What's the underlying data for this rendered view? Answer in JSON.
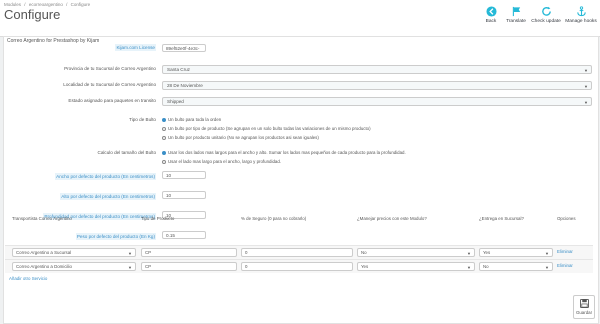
{
  "breadcrumb": [
    "Modules",
    "/",
    "ecorreoargentino",
    "/",
    "Configure"
  ],
  "page_title": "Configure",
  "toolbar": [
    {
      "label": "Back",
      "icon": "back-arrow-icon"
    },
    {
      "label": "Translate",
      "icon": "flag-icon"
    },
    {
      "label": "Check update",
      "icon": "refresh-icon"
    },
    {
      "label": "Manage hooks",
      "icon": "anchor-icon"
    }
  ],
  "module_title": "Correo Argentino for Prestashop by Kijam",
  "form": {
    "license_label": "Kijam.com License",
    "license_value": "89ef52e0f-4e3c-",
    "province_label": "Provincia de tu Sucursal de Correo Argentino",
    "province_value": "Santa Cruz",
    "locality_label": "Localidad de tu Sucursal de Correo Argentino",
    "locality_value": "28 De Noviembre",
    "state_label": "Estado asignado para paquetes en transito",
    "state_value": "Shipped",
    "package_type_label": "Tipo de Bulto",
    "package_type_options": [
      "Un bulto para toda la orden",
      "Un bulto por tipo de producto (Se agrupan en un solo bulto todas las variaciones de un mismo producto)",
      "Un bulto por producto unitario (No se agrupan los productos asi sean iguales)"
    ],
    "package_calc_label": "Calculo del tamaño del Bulto",
    "package_calc_options": [
      "Usar los dos lados mas largos para el ancho y alto. Sumar los lados mas pequeños de cada producto para la profundidad.",
      "Usar el lado mas largo para el ancho, largo y profundidad."
    ],
    "width_label": "Ancho por defecto del producto (En centimetros)",
    "width_value": "10",
    "height_label": "Alto por defecto del producto (En centimetros)",
    "height_value": "10",
    "depth_label": "Profundidad por defecto del producto (En centimetros)",
    "depth_value": "10",
    "weight_label": "Peso por defecto del producto (En Kg)",
    "weight_value": "0.15"
  },
  "table": {
    "headers": [
      "Transportista Correo Argentino",
      "Tipo de Producto",
      "% de Seguro (0 para no cobrarlo)",
      "¿Manejar precios con este Modulo?",
      "¿Entrega en Sucursal?",
      "Opciones"
    ],
    "rows": [
      {
        "carrier": "Correo Argentino a Sucursal",
        "product_type": "CP",
        "insurance": "0",
        "manage_prices": "No",
        "branch_delivery": "Yes",
        "option": "Eliminar"
      },
      {
        "carrier": "Correo Argentino a Domicilio",
        "product_type": "CP",
        "insurance": "0",
        "manage_prices": "Yes",
        "branch_delivery": "No",
        "option": "Eliminar"
      }
    ],
    "add_link": "Añadir otro Servicio"
  },
  "save_label": "Guardar",
  "colors": {
    "accent": "#3b8fc7",
    "background": "#eff1f2"
  }
}
